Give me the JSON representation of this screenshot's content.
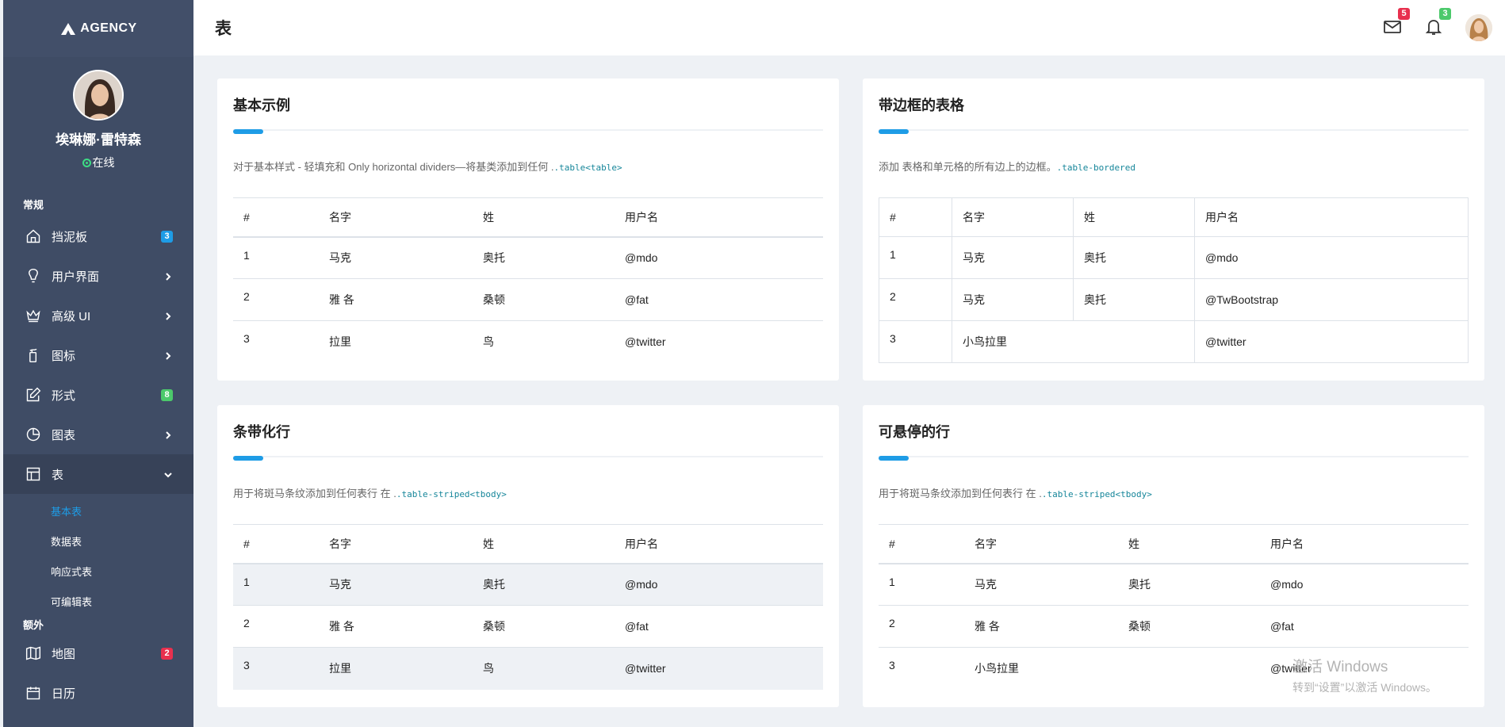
{
  "brand": {
    "name": "AGENCY"
  },
  "profile": {
    "name": "埃琳娜·雷特森",
    "status": "在线"
  },
  "sidebar": {
    "heading_general": "常规",
    "heading_extra": "额外",
    "items": [
      {
        "label": "挡泥板",
        "icon": "home-icon",
        "badge": "3",
        "badge_color": "#1e9ce6"
      },
      {
        "label": "用户界面",
        "icon": "lightbulb-icon"
      },
      {
        "label": "高级 UI",
        "icon": "crown-icon"
      },
      {
        "label": "图标",
        "icon": "extinguisher-icon"
      },
      {
        "label": "形式",
        "icon": "edit-icon",
        "badge": "8",
        "badge_color": "#4cc96b"
      },
      {
        "label": "图表",
        "icon": "pie-chart-icon"
      },
      {
        "label": "表",
        "icon": "layout-icon"
      }
    ],
    "sub_items": [
      "基本表",
      "数据表",
      "响应式表",
      "可编辑表"
    ],
    "extra_items": [
      {
        "label": "地图",
        "icon": "map-icon",
        "badge": "2",
        "badge_color": "#e8304e"
      },
      {
        "label": "日历",
        "icon": "calendar-icon"
      }
    ]
  },
  "header": {
    "title": "表",
    "mail_badge": "5",
    "mail_badge_color": "#e8304e",
    "bell_badge": "3",
    "bell_badge_color": "#4cc96b"
  },
  "columns": [
    "#",
    "名字",
    "姓",
    "用户名"
  ],
  "cards": {
    "basic": {
      "title": "基本示例",
      "desc": "对于基本样式 - 轻填充和 Only horizontal dividers—将基类添加到任何 .",
      "code": ".table<table>",
      "rows": [
        [
          "1",
          "马克",
          "奥托",
          "@mdo"
        ],
        [
          "2",
          "雅 各",
          "桑顿",
          "@fat"
        ],
        [
          "3",
          "拉里",
          "鸟",
          "@twitter"
        ]
      ]
    },
    "bordered": {
      "title": "带边框的表格",
      "desc": "添加 表格和单元格的所有边上的边框。",
      "code": ".table-bordered",
      "rows": [
        [
          "1",
          "马克",
          "奥托",
          "@mdo"
        ],
        [
          "2",
          "马克",
          "奥托",
          "@TwBootstrap"
        ],
        [
          "3",
          "小鸟拉里",
          "",
          "@twitter"
        ]
      ]
    },
    "striped": {
      "title": "条带化行",
      "desc": "用于将斑马条纹添加到任何表行 在 .",
      "code": ".table-striped<tbody>",
      "rows": [
        [
          "1",
          "马克",
          "奥托",
          "@mdo"
        ],
        [
          "2",
          "雅 各",
          "桑顿",
          "@fat"
        ],
        [
          "3",
          "拉里",
          "鸟",
          "@twitter"
        ]
      ]
    },
    "hover": {
      "title": "可悬停的行",
      "desc": "用于将斑马条纹添加到任何表行 在 .",
      "code": ".table-striped<tbody>",
      "rows": [
        [
          "1",
          "马克",
          "奥托",
          "@mdo"
        ],
        [
          "2",
          "雅 各",
          "桑顿",
          "@fat"
        ],
        [
          "3",
          "小鸟拉里",
          "",
          "@twitter"
        ]
      ]
    }
  },
  "watermark": {
    "line1": "激活 Windows",
    "line2": "转到“设置”以激活 Windows。"
  }
}
